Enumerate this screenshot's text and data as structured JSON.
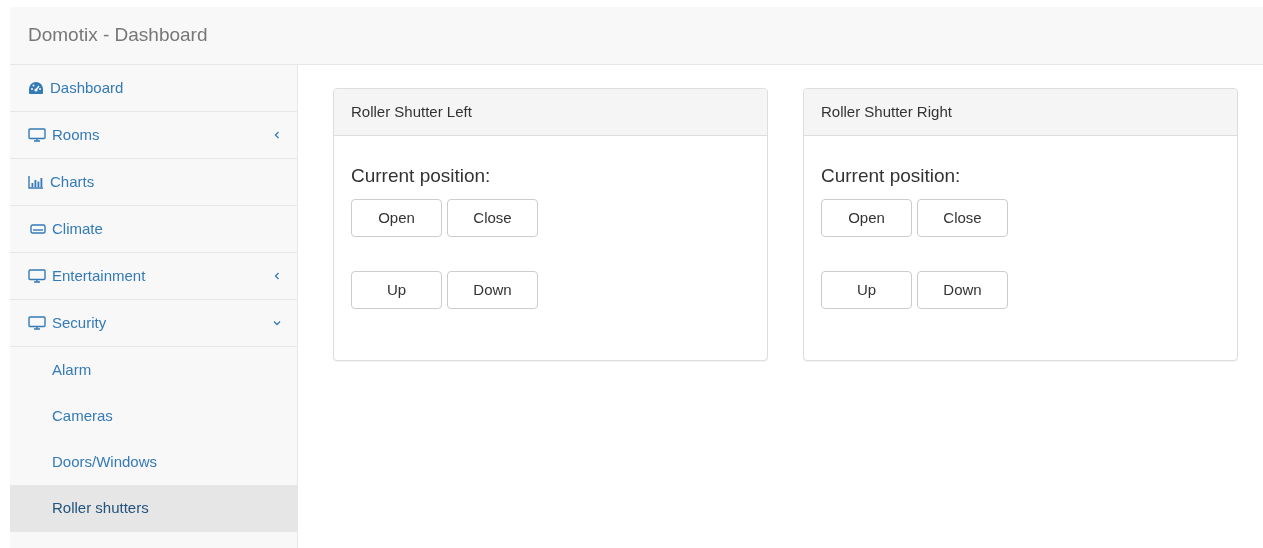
{
  "header": {
    "title": "Domotix - Dashboard"
  },
  "sidebar": {
    "items": [
      {
        "label": "Dashboard",
        "selected": false
      },
      {
        "label": "Rooms",
        "selected": false,
        "expanded": false
      },
      {
        "label": "Charts",
        "selected": false
      },
      {
        "label": "Climate",
        "selected": false
      },
      {
        "label": "Entertainment",
        "selected": false,
        "expanded": false
      },
      {
        "label": "Security",
        "selected": false,
        "expanded": true,
        "children": [
          {
            "label": "Alarm",
            "selected": false
          },
          {
            "label": "Cameras",
            "selected": false
          },
          {
            "label": "Doors/Windows",
            "selected": false
          },
          {
            "label": "Roller shutters",
            "selected": true
          }
        ]
      }
    ]
  },
  "panels": [
    {
      "title": "Roller Shutter Left",
      "position_label": "Current position:",
      "button_rows": [
        [
          "Open",
          "Close"
        ],
        [
          "Up",
          "Down"
        ]
      ]
    },
    {
      "title": "Roller Shutter Right",
      "position_label": "Current position:",
      "button_rows": [
        [
          "Open",
          "Close"
        ],
        [
          "Up",
          "Down"
        ]
      ]
    }
  ]
}
